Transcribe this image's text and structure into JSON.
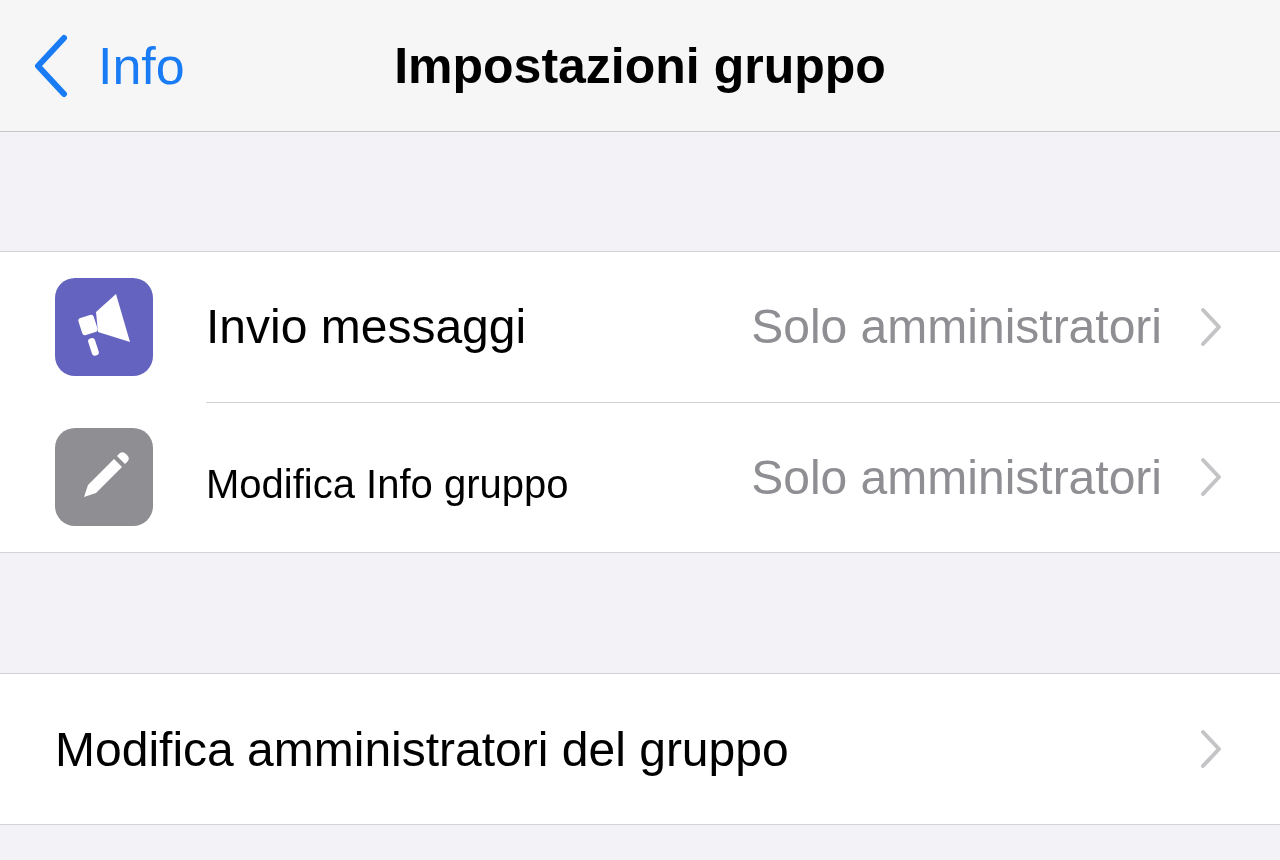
{
  "nav": {
    "back": "Info",
    "title": "Impostazioni gruppo"
  },
  "settings": [
    {
      "kind": "megaphone",
      "color": "#6563c0",
      "label": "Invio messaggi",
      "value": "Solo amministratori"
    },
    {
      "kind": "pencil",
      "color": "#8e8e93",
      "label": "Modifica Info gruppo",
      "value": "Solo amministratori"
    }
  ],
  "admins": {
    "label": "Modifica amministratori del gruppo"
  }
}
